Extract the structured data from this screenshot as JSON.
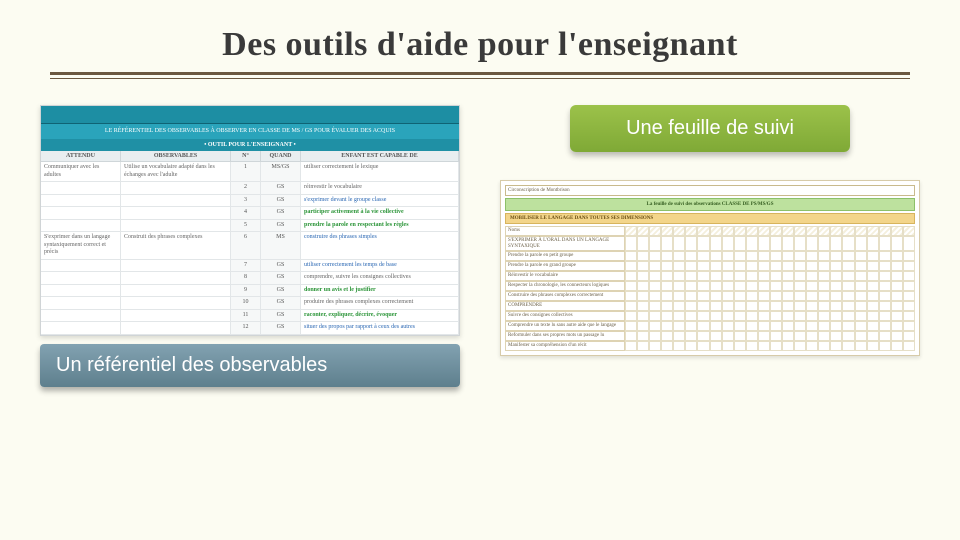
{
  "title": "Des outils d'aide pour l'enseignant",
  "left": {
    "banner": "LE RÉFÉRENTIEL DES OBSERVABLES À OBSERVER EN CLASSE DE MS / GS POUR ÉVALUER DES ACQUIS",
    "sub": "• OUTIL POUR L'ENSEIGNANT •",
    "headers": [
      "ATTENDU",
      "OBSERVABLES",
      "N°",
      "QUAND",
      "ENFANT EST CAPABLE DE"
    ],
    "rows": [
      {
        "a": "Communiquer avec les adultes",
        "b": "Utilise un vocabulaire adapté dans les échanges avec l'adulte",
        "n": "1",
        "q": "MS/GS",
        "c": "utiliser correctement le lexique"
      },
      {
        "a": "",
        "b": "",
        "n": "2",
        "q": "GS",
        "c": "réinvestir le vocabulaire"
      },
      {
        "a": "",
        "b": "",
        "n": "3",
        "q": "GS",
        "c": "s'exprimer devant le groupe classe",
        "cls": "blue"
      },
      {
        "a": "",
        "b": "",
        "n": "4",
        "q": "GS",
        "c": "participer activement à la vie collective",
        "cls": "green"
      },
      {
        "a": "",
        "b": "",
        "n": "5",
        "q": "GS",
        "c": "prendre la parole en respectant les règles",
        "cls": "green"
      },
      {
        "a": "S'exprimer dans un langage syntaxiquement correct et précis",
        "b": "Construit des phrases complexes",
        "n": "6",
        "q": "MS",
        "c": "construire des phrases simples",
        "cls": "blue"
      },
      {
        "a": "",
        "b": "",
        "n": "7",
        "q": "GS",
        "c": "utiliser correctement les temps de base",
        "cls": "blue"
      },
      {
        "a": "",
        "b": "",
        "n": "8",
        "q": "GS",
        "c": "comprendre, suivre les consignes collectives"
      },
      {
        "a": "",
        "b": "",
        "n": "9",
        "q": "GS",
        "c": "donner un avis et le justifier",
        "cls": "green"
      },
      {
        "a": "",
        "b": "",
        "n": "10",
        "q": "GS",
        "c": "produire des phrases complexes correctement"
      },
      {
        "a": "",
        "b": "",
        "n": "11",
        "q": "GS",
        "c": "raconter, expliquer, décrire, évoquer",
        "cls": "green"
      },
      {
        "a": "",
        "b": "",
        "n": "12",
        "q": "GS",
        "c": "situer des propos par rapport à ceux des autres",
        "cls": "blue"
      }
    ],
    "label": "Un référentiel des observables"
  },
  "right": {
    "button": "Une feuille de suivi",
    "sheet_head1": "Circonscription de Montbrison",
    "sheet_head2": "La feuille de suivi des observations CLASSE DE PS/MS/GS",
    "sheet_head3": "MOBILISER LE LANGAGE DANS TOUTES SES DIMENSIONS",
    "names_row": "Noms",
    "rows": [
      "S'EXPRIMER À L'ORAL DANS UN LANGAGE SYNTAXIQUE",
      "Prendre la parole en petit groupe",
      "Prendre la parole en grand groupe",
      "Réinvestir le vocabulaire",
      "Respecter la chronologie, les connecteurs logiques",
      "Construire des phrases complexes correctement",
      "COMPRENDRE",
      "Suivre des consignes collectives",
      "Comprendre un texte lu sans autre aide que le langage",
      "Reformuler dans ses propres mots un passage lu",
      "Manifester sa compréhension d'un récit"
    ]
  }
}
